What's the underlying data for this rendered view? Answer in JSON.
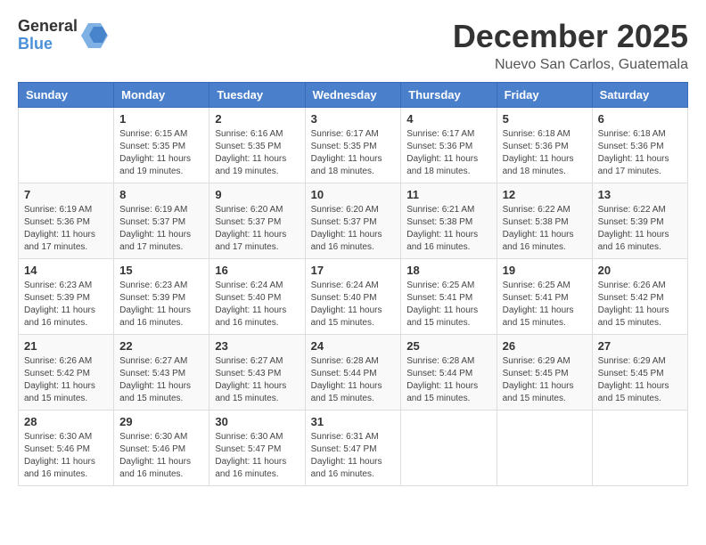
{
  "logo": {
    "general": "General",
    "blue": "Blue"
  },
  "title": "December 2025",
  "location": "Nuevo San Carlos, Guatemala",
  "headers": [
    "Sunday",
    "Monday",
    "Tuesday",
    "Wednesday",
    "Thursday",
    "Friday",
    "Saturday"
  ],
  "weeks": [
    [
      {
        "day": "",
        "info": ""
      },
      {
        "day": "1",
        "info": "Sunrise: 6:15 AM\nSunset: 5:35 PM\nDaylight: 11 hours and 19 minutes."
      },
      {
        "day": "2",
        "info": "Sunrise: 6:16 AM\nSunset: 5:35 PM\nDaylight: 11 hours and 19 minutes."
      },
      {
        "day": "3",
        "info": "Sunrise: 6:17 AM\nSunset: 5:35 PM\nDaylight: 11 hours and 18 minutes."
      },
      {
        "day": "4",
        "info": "Sunrise: 6:17 AM\nSunset: 5:36 PM\nDaylight: 11 hours and 18 minutes."
      },
      {
        "day": "5",
        "info": "Sunrise: 6:18 AM\nSunset: 5:36 PM\nDaylight: 11 hours and 18 minutes."
      },
      {
        "day": "6",
        "info": "Sunrise: 6:18 AM\nSunset: 5:36 PM\nDaylight: 11 hours and 17 minutes."
      }
    ],
    [
      {
        "day": "7",
        "info": "Sunrise: 6:19 AM\nSunset: 5:36 PM\nDaylight: 11 hours and 17 minutes."
      },
      {
        "day": "8",
        "info": "Sunrise: 6:19 AM\nSunset: 5:37 PM\nDaylight: 11 hours and 17 minutes."
      },
      {
        "day": "9",
        "info": "Sunrise: 6:20 AM\nSunset: 5:37 PM\nDaylight: 11 hours and 17 minutes."
      },
      {
        "day": "10",
        "info": "Sunrise: 6:20 AM\nSunset: 5:37 PM\nDaylight: 11 hours and 16 minutes."
      },
      {
        "day": "11",
        "info": "Sunrise: 6:21 AM\nSunset: 5:38 PM\nDaylight: 11 hours and 16 minutes."
      },
      {
        "day": "12",
        "info": "Sunrise: 6:22 AM\nSunset: 5:38 PM\nDaylight: 11 hours and 16 minutes."
      },
      {
        "day": "13",
        "info": "Sunrise: 6:22 AM\nSunset: 5:39 PM\nDaylight: 11 hours and 16 minutes."
      }
    ],
    [
      {
        "day": "14",
        "info": "Sunrise: 6:23 AM\nSunset: 5:39 PM\nDaylight: 11 hours and 16 minutes."
      },
      {
        "day": "15",
        "info": "Sunrise: 6:23 AM\nSunset: 5:39 PM\nDaylight: 11 hours and 16 minutes."
      },
      {
        "day": "16",
        "info": "Sunrise: 6:24 AM\nSunset: 5:40 PM\nDaylight: 11 hours and 16 minutes."
      },
      {
        "day": "17",
        "info": "Sunrise: 6:24 AM\nSunset: 5:40 PM\nDaylight: 11 hours and 15 minutes."
      },
      {
        "day": "18",
        "info": "Sunrise: 6:25 AM\nSunset: 5:41 PM\nDaylight: 11 hours and 15 minutes."
      },
      {
        "day": "19",
        "info": "Sunrise: 6:25 AM\nSunset: 5:41 PM\nDaylight: 11 hours and 15 minutes."
      },
      {
        "day": "20",
        "info": "Sunrise: 6:26 AM\nSunset: 5:42 PM\nDaylight: 11 hours and 15 minutes."
      }
    ],
    [
      {
        "day": "21",
        "info": "Sunrise: 6:26 AM\nSunset: 5:42 PM\nDaylight: 11 hours and 15 minutes."
      },
      {
        "day": "22",
        "info": "Sunrise: 6:27 AM\nSunset: 5:43 PM\nDaylight: 11 hours and 15 minutes."
      },
      {
        "day": "23",
        "info": "Sunrise: 6:27 AM\nSunset: 5:43 PM\nDaylight: 11 hours and 15 minutes."
      },
      {
        "day": "24",
        "info": "Sunrise: 6:28 AM\nSunset: 5:44 PM\nDaylight: 11 hours and 15 minutes."
      },
      {
        "day": "25",
        "info": "Sunrise: 6:28 AM\nSunset: 5:44 PM\nDaylight: 11 hours and 15 minutes."
      },
      {
        "day": "26",
        "info": "Sunrise: 6:29 AM\nSunset: 5:45 PM\nDaylight: 11 hours and 15 minutes."
      },
      {
        "day": "27",
        "info": "Sunrise: 6:29 AM\nSunset: 5:45 PM\nDaylight: 11 hours and 15 minutes."
      }
    ],
    [
      {
        "day": "28",
        "info": "Sunrise: 6:30 AM\nSunset: 5:46 PM\nDaylight: 11 hours and 16 minutes."
      },
      {
        "day": "29",
        "info": "Sunrise: 6:30 AM\nSunset: 5:46 PM\nDaylight: 11 hours and 16 minutes."
      },
      {
        "day": "30",
        "info": "Sunrise: 6:30 AM\nSunset: 5:47 PM\nDaylight: 11 hours and 16 minutes."
      },
      {
        "day": "31",
        "info": "Sunrise: 6:31 AM\nSunset: 5:47 PM\nDaylight: 11 hours and 16 minutes."
      },
      {
        "day": "",
        "info": ""
      },
      {
        "day": "",
        "info": ""
      },
      {
        "day": "",
        "info": ""
      }
    ]
  ]
}
